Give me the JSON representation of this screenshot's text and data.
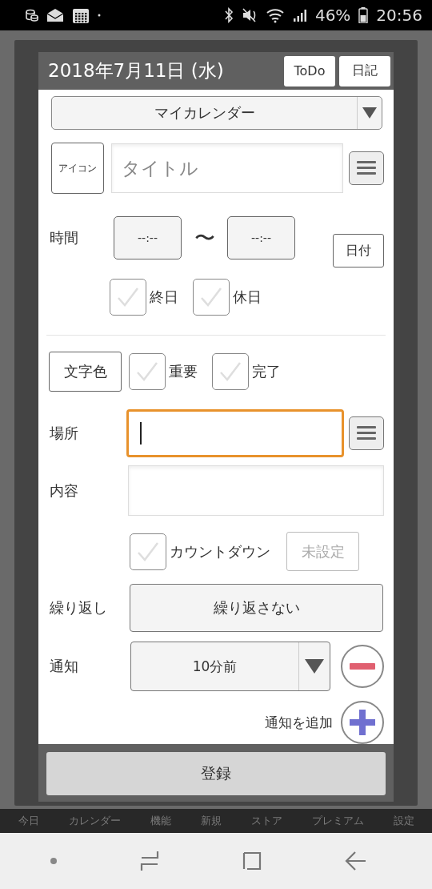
{
  "status_bar": {
    "battery": "46%",
    "time": "20:56"
  },
  "dialog": {
    "date": "2018年7月11日 (水)",
    "header_buttons": [
      "ToDo",
      "日記"
    ],
    "calendar_select": "マイカレンダー",
    "icon_button": "アイコン",
    "title": {
      "placeholder": "タイトル"
    },
    "time": {
      "label": "時間",
      "start": "--:--",
      "separator": "〜",
      "end": "--:--",
      "date_button": "日付"
    },
    "day_options": [
      {
        "label": "終日",
        "checked": false
      },
      {
        "label": "休日",
        "checked": false
      }
    ],
    "text_color_button": "文字色",
    "flags": [
      {
        "label": "重要",
        "checked": false
      },
      {
        "label": "完了",
        "checked": false
      }
    ],
    "place": {
      "label": "場所",
      "focused": true
    },
    "content": {
      "label": "内容"
    },
    "countdown": {
      "label": "カウントダウン",
      "checked": false,
      "button": "未設定",
      "disabled": true
    },
    "repeat": {
      "label": "繰り返し",
      "value": "繰り返さない"
    },
    "notification": {
      "label": "通知",
      "value": "10分前"
    },
    "add_notification": "通知を追加",
    "submit": "登録"
  },
  "tab_bar": [
    "今日",
    "カレンダー",
    "機能",
    "新規",
    "ストア",
    "プレミアム",
    "設定"
  ]
}
